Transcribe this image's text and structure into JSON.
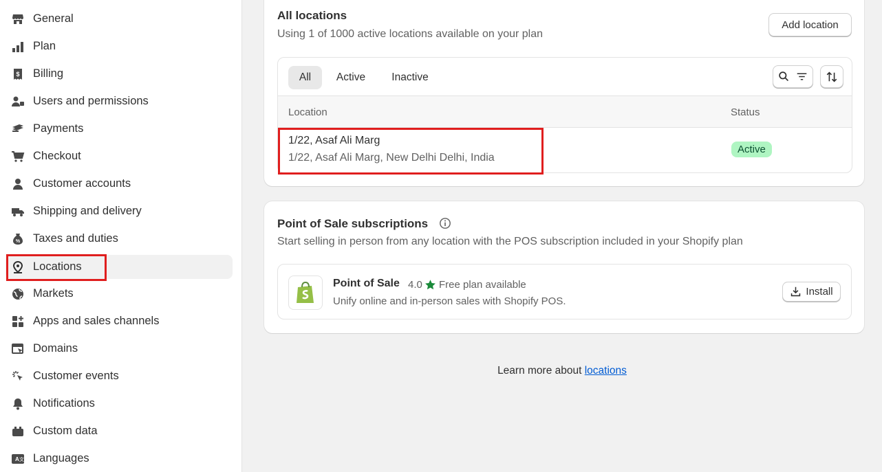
{
  "sidebar": {
    "items": [
      {
        "label": "General",
        "icon": "store-icon"
      },
      {
        "label": "Plan",
        "icon": "plan-icon"
      },
      {
        "label": "Billing",
        "icon": "billing-icon"
      },
      {
        "label": "Users and permissions",
        "icon": "users-icon"
      },
      {
        "label": "Payments",
        "icon": "payments-icon"
      },
      {
        "label": "Checkout",
        "icon": "cart-icon"
      },
      {
        "label": "Customer accounts",
        "icon": "person-icon"
      },
      {
        "label": "Shipping and delivery",
        "icon": "truck-icon"
      },
      {
        "label": "Taxes and duties",
        "icon": "tax-icon"
      },
      {
        "label": "Locations",
        "icon": "location-pin-icon",
        "active": true
      },
      {
        "label": "Markets",
        "icon": "globe-icon"
      },
      {
        "label": "Apps and sales channels",
        "icon": "apps-icon"
      },
      {
        "label": "Domains",
        "icon": "domains-icon"
      },
      {
        "label": "Customer events",
        "icon": "cursor-click-icon"
      },
      {
        "label": "Notifications",
        "icon": "bell-icon"
      },
      {
        "label": "Custom data",
        "icon": "custom-data-icon"
      },
      {
        "label": "Languages",
        "icon": "translate-icon"
      }
    ]
  },
  "locations_card": {
    "title": "All locations",
    "subtitle": "Using 1 of 1000 active locations available on your plan",
    "add_button": "Add location",
    "tabs": [
      "All",
      "Active",
      "Inactive"
    ],
    "columns": {
      "location": "Location",
      "status": "Status"
    },
    "rows": [
      {
        "name": "1/22, Asaf Ali Marg",
        "address": "1/22, Asaf Ali Marg, New Delhi Delhi, India",
        "status": "Active"
      }
    ]
  },
  "pos_card": {
    "title": "Point of Sale subscriptions",
    "subtitle": "Start selling in person from any location with the POS subscription included in your Shopify plan",
    "app": {
      "name": "Point of Sale",
      "rating": "4.0",
      "pricing": "Free plan available",
      "description": "Unify online and in-person sales with Shopify POS.",
      "install_label": "Install"
    }
  },
  "footer": {
    "text": "Learn more about ",
    "link": "locations"
  },
  "colors": {
    "active_badge_bg": "#aff5c2",
    "highlight": "#e01e1e",
    "link": "#005bd3",
    "star": "#1a8a3a",
    "shopify_green": "#95bf47"
  }
}
